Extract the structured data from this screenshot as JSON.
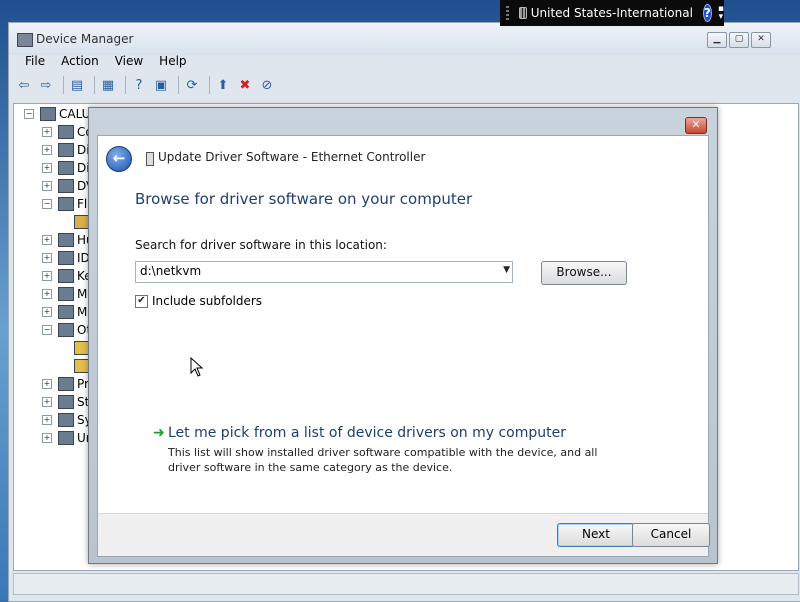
{
  "language_bar": {
    "language": "United States-International",
    "help_glyph": "?"
  },
  "device_manager": {
    "title": "Device Manager",
    "menu": [
      "File",
      "Action",
      "View",
      "Help"
    ],
    "tree": {
      "root": "CALU",
      "items": [
        "Co",
        "Di",
        "Di",
        "DV",
        "Fl",
        "",
        "Hu",
        "ID",
        "Ke",
        "M",
        "M",
        "Ot",
        "",
        "",
        "Pr",
        "St",
        "Sy",
        "Ur"
      ]
    }
  },
  "dialog": {
    "heading": "Update Driver Software - Ethernet Controller",
    "main_title": "Browse for driver software on your computer",
    "search_label": "Search for driver software in this location:",
    "path_value": "d:\\netkvm",
    "browse_label": "Browse...",
    "include_subfolders_label": "Include subfolders",
    "include_subfolders_checked": true,
    "pick_title": "Let me pick from a list of device drivers on my computer",
    "pick_desc": "This list will show installed driver software compatible with the device, and all driver software in the same category as the device.",
    "next_label": "Next",
    "cancel_label": "Cancel"
  }
}
